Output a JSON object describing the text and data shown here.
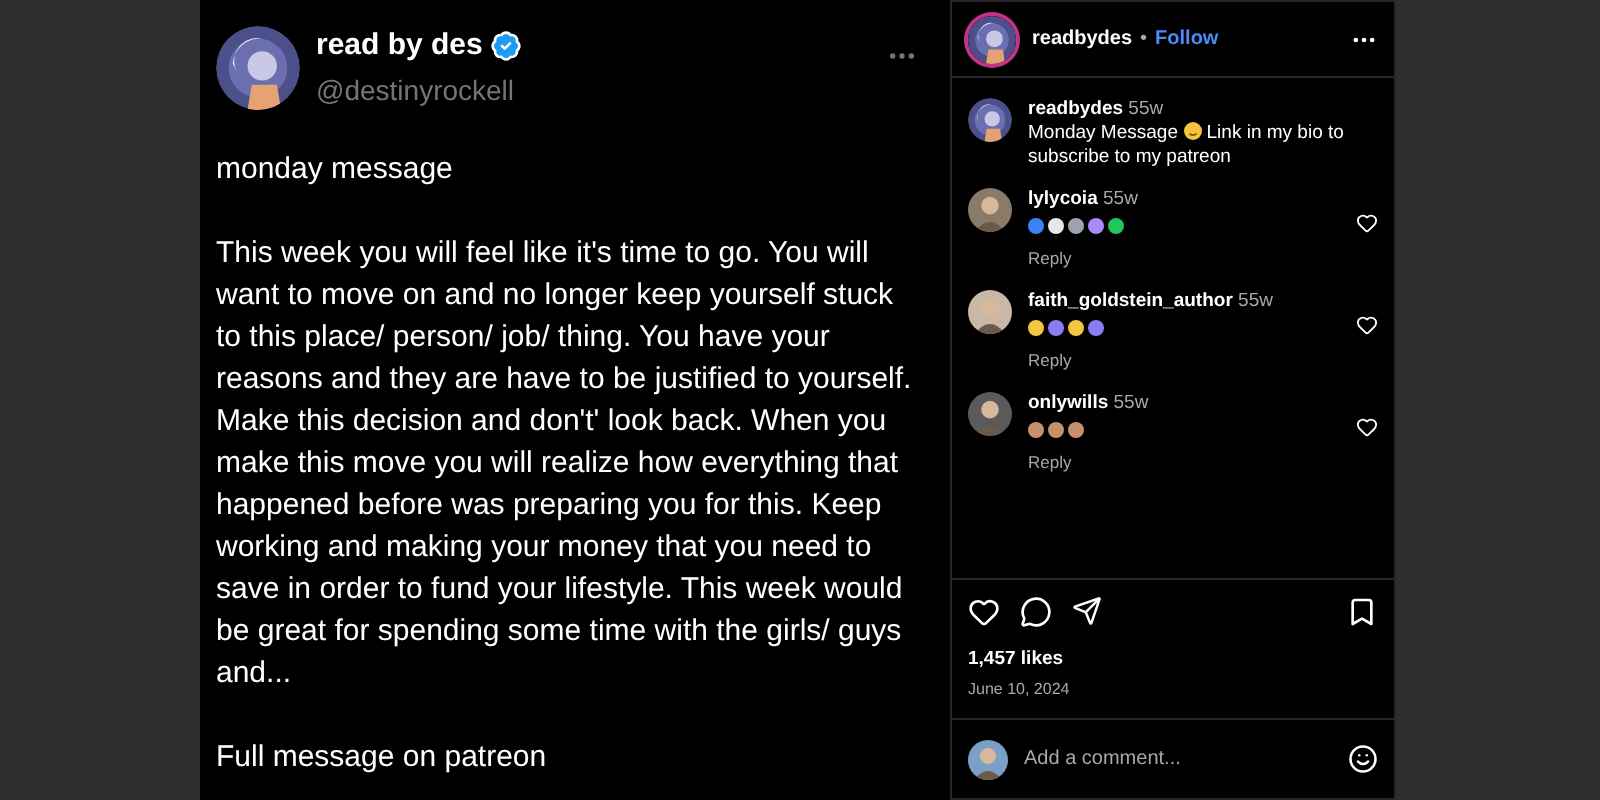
{
  "tweet": {
    "name": "read by des",
    "verified": true,
    "handle": "@destinyrockell",
    "paragraphs": [
      "monday message",
      "This week you will feel like it's time to go. You will want to move on and no longer keep yourself stuck to this place/ person/ job/ thing. You have your reasons and they are have to be justified to yourself. Make this decision and don't' look back. When you make this move you will realize how everything that happened before was preparing you for this. Keep working and making your money that you need to save in order to fund your lifestyle. This week would be great for spending some time with the girls/ guys and...",
      "Full message on patreon"
    ]
  },
  "post": {
    "username": "readbydes",
    "separator": "•",
    "follow": "Follow",
    "caption": {
      "username": "readbydes",
      "time": "55w",
      "text_before": "Monday Message",
      "text_after": "Link in my bio to subscribe to my patreon"
    },
    "comments": [
      {
        "username": "lylycoia",
        "time": "55w",
        "reply": "Reply",
        "emojis": [
          {
            "color": "#3b82f6"
          },
          {
            "color": "#e5e7eb"
          },
          {
            "color": "#9ca3af"
          },
          {
            "color": "#a78bfa"
          },
          {
            "color": "#22c55e"
          }
        ]
      },
      {
        "username": "faith_goldstein_author",
        "time": "55w",
        "reply": "Reply",
        "emojis": [
          {
            "color": "#f5c542"
          },
          {
            "color": "#8b7cf6"
          },
          {
            "color": "#f5c542"
          },
          {
            "color": "#8b7cf6"
          }
        ]
      },
      {
        "username": "onlywills",
        "time": "55w",
        "reply": "Reply",
        "emojis": [
          {
            "color": "#c8906a"
          },
          {
            "color": "#c8906a"
          },
          {
            "color": "#c8906a"
          }
        ]
      }
    ],
    "likes": "1,457 likes",
    "date": "June 10, 2024",
    "comment_placeholder": "Add a comment..."
  }
}
